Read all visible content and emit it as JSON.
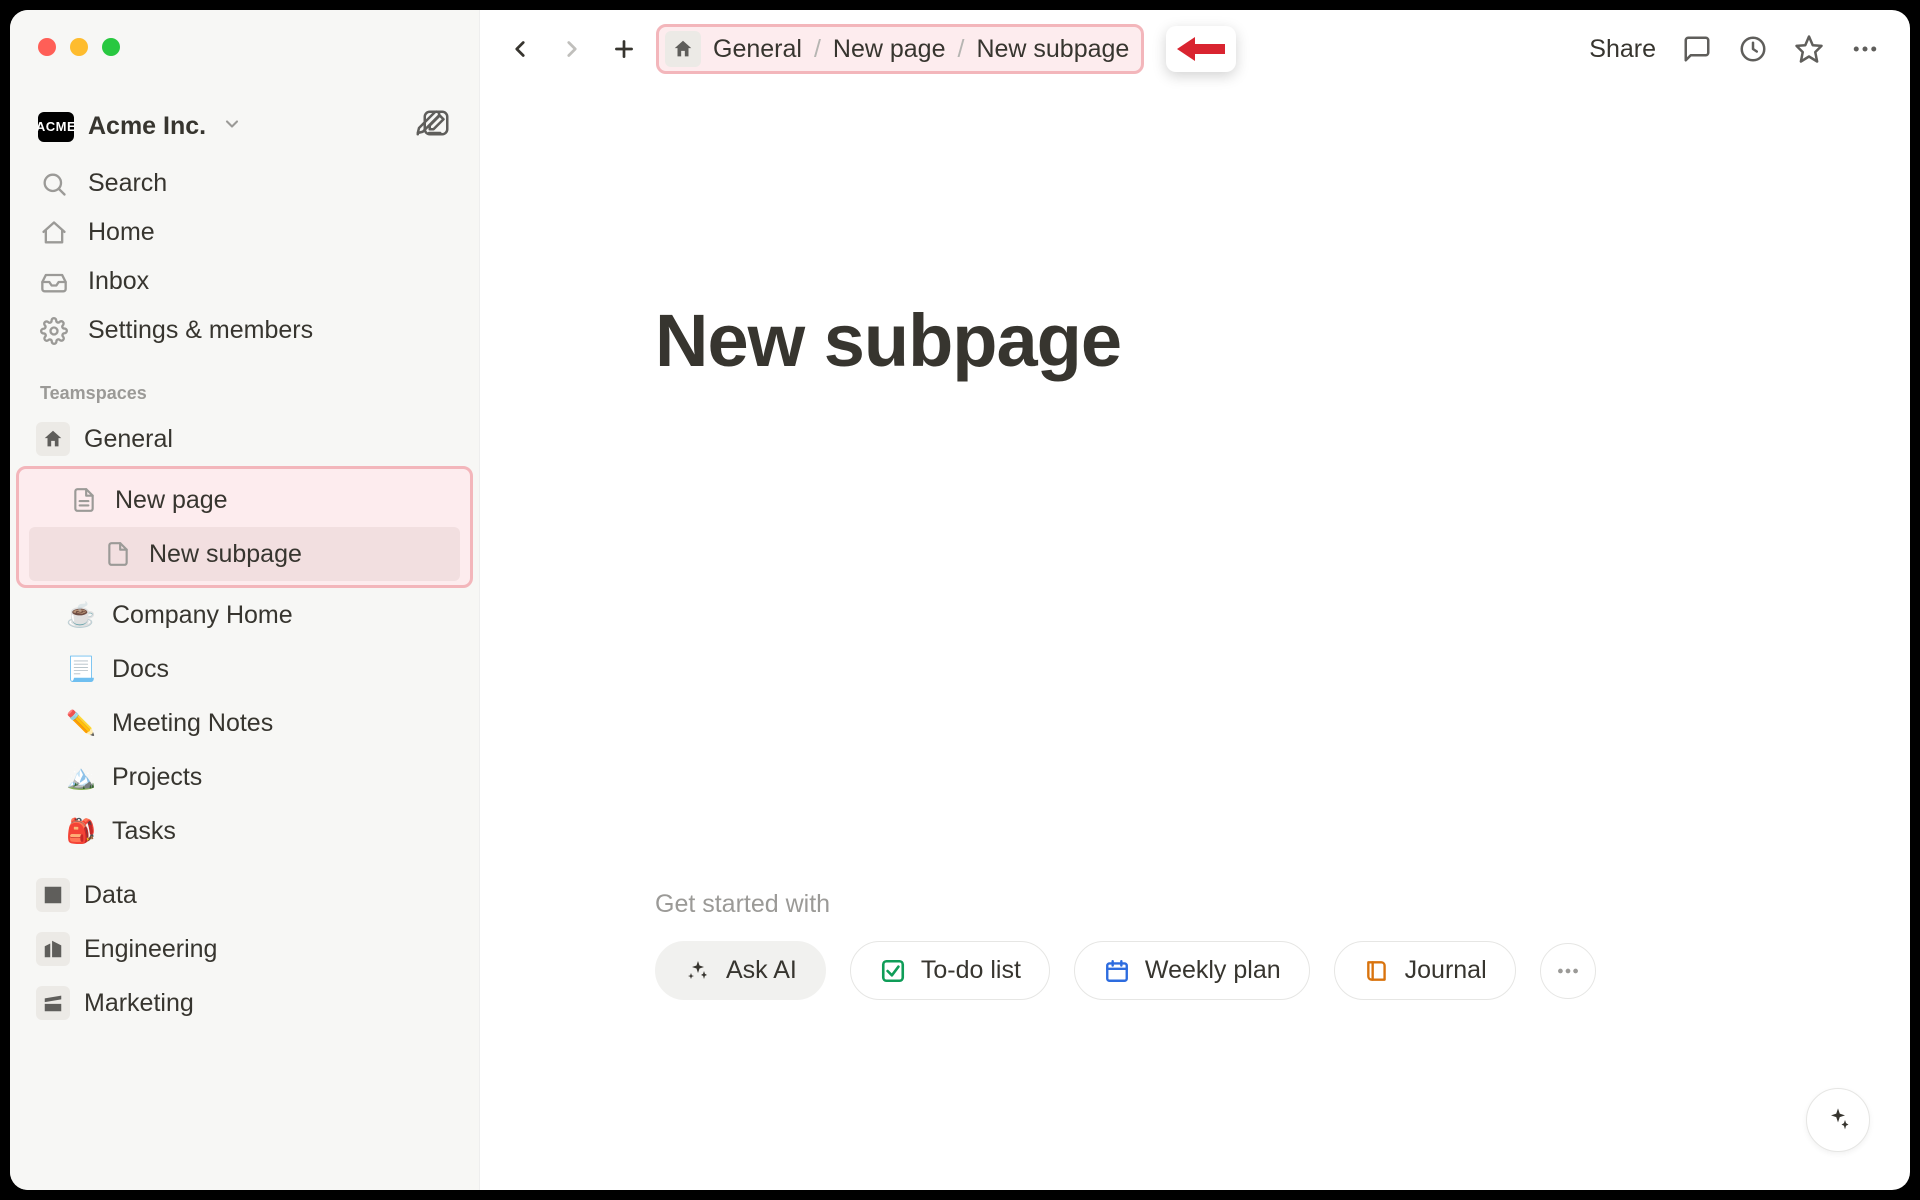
{
  "workspace": {
    "badge": "ACME",
    "name": "Acme Inc."
  },
  "sidebar": {
    "search": "Search",
    "home": "Home",
    "inbox": "Inbox",
    "settings": "Settings & members",
    "section_label": "Teamspaces",
    "general": "General",
    "new_page": "New page",
    "new_subpage": "New subpage",
    "company_home": "Company Home",
    "docs": "Docs",
    "meeting_notes": "Meeting Notes",
    "projects": "Projects",
    "tasks": "Tasks",
    "data": "Data",
    "engineering": "Engineering",
    "marketing": "Marketing"
  },
  "breadcrumb": {
    "item1": "General",
    "item2": "New page",
    "item3": "New subpage"
  },
  "topbar": {
    "share": "Share"
  },
  "page": {
    "title": "New subpage"
  },
  "starter": {
    "label": "Get started with",
    "ask_ai": "Ask AI",
    "todo": "To-do list",
    "weekly": "Weekly plan",
    "journal": "Journal"
  }
}
